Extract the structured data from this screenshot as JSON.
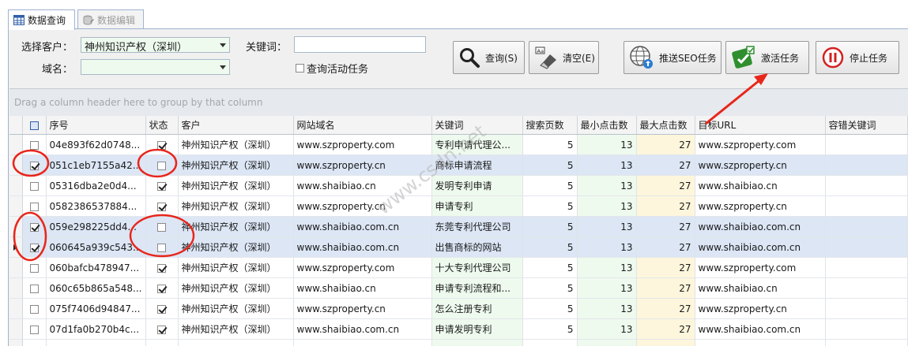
{
  "tabs": [
    {
      "label": "数据查询"
    },
    {
      "label": "数据编辑"
    }
  ],
  "filters": {
    "customer_label": "选择客户：",
    "customer_value": "神州知识产权（深圳）",
    "domain_label": "域名：",
    "domain_value": "",
    "keyword_label": "关键词：",
    "keyword_value": "",
    "active_task_label": "查询活动任务"
  },
  "buttons": {
    "query": "查询(S)",
    "clear": "清空(E)",
    "push_seo": "推送SEO任务",
    "activate": "激活任务",
    "stop": "停止任务"
  },
  "group_hint": "Drag a column header here to group by that column",
  "columns": [
    "序号",
    "状态",
    "客户",
    "网站域名",
    "关键词",
    "搜索页数",
    "最小点击数",
    "最大点击数",
    "目标URL",
    "容错关键词"
  ],
  "rows": [
    {
      "checked": false,
      "id": "04e893f62d0748...",
      "status": true,
      "customer": "神州知识产权（深圳）",
      "domain": "www.szproperty.com",
      "keyword": "专利申请代理公...",
      "pages": "5",
      "min": "13",
      "max": "27",
      "url": "www.szproperty.com",
      "fault_kw": "",
      "selected": false,
      "current": false
    },
    {
      "checked": true,
      "id": "051c1eb7155a42...",
      "status": false,
      "customer": "神州知识产权（深圳）",
      "domain": "www.szproperty.cn",
      "keyword": "商标申请流程",
      "pages": "5",
      "min": "13",
      "max": "27",
      "url": "www.szproperty.cn",
      "fault_kw": "",
      "selected": true,
      "current": false
    },
    {
      "checked": false,
      "id": "05316dba2e0d4...",
      "status": true,
      "customer": "神州知识产权（深圳）",
      "domain": "www.shaibiao.cn",
      "keyword": "发明专利申请",
      "pages": "5",
      "min": "13",
      "max": "27",
      "url": "www.shaibiao.cn",
      "fault_kw": "",
      "selected": false,
      "current": false
    },
    {
      "checked": false,
      "id": "0582386537884...",
      "status": true,
      "customer": "神州知识产权（深圳）",
      "domain": "www.szproperty.cn",
      "keyword": "申请专利",
      "pages": "5",
      "min": "13",
      "max": "27",
      "url": "www.szproperty.cn",
      "fault_kw": "",
      "selected": false,
      "current": false
    },
    {
      "checked": true,
      "id": "059e298225dd4...",
      "status": false,
      "customer": "神州知识产权（深圳）",
      "domain": "www.shaibiao.com.cn",
      "keyword": "东莞专利代理公司",
      "pages": "5",
      "min": "13",
      "max": "27",
      "url": "www.shaibiao.com.cn",
      "fault_kw": "",
      "selected": true,
      "current": false
    },
    {
      "checked": true,
      "id": "060645a939c543...",
      "status": false,
      "customer": "神州知识产权（深圳）",
      "domain": "www.shaibiao.com.cn",
      "keyword": "出售商标的网站",
      "pages": "5",
      "min": "13",
      "max": "27",
      "url": "www.shaibiao.com.cn",
      "fault_kw": "",
      "selected": true,
      "current": true
    },
    {
      "checked": false,
      "id": "060bafcb478947...",
      "status": true,
      "customer": "神州知识产权（深圳）",
      "domain": "www.szproperty.com",
      "keyword": "十大专利代理公司",
      "pages": "5",
      "min": "13",
      "max": "27",
      "url": "www.szproperty.com",
      "fault_kw": "",
      "selected": false,
      "current": false
    },
    {
      "checked": false,
      "id": "060c65b865a548...",
      "status": true,
      "customer": "神州知识产权（深圳）",
      "domain": "www.shaibiao.cn",
      "keyword": "申请专利流程和...",
      "pages": "5",
      "min": "13",
      "max": "27",
      "url": "www.shaibiao.cn",
      "fault_kw": "",
      "selected": false,
      "current": false
    },
    {
      "checked": false,
      "id": "075f7406d94847...",
      "status": true,
      "customer": "神州知识产权（深圳）",
      "domain": "www.szproperty.cn",
      "keyword": "怎么注册专利",
      "pages": "5",
      "min": "13",
      "max": "27",
      "url": "www.szproperty.cn",
      "fault_kw": "",
      "selected": false,
      "current": false
    },
    {
      "checked": false,
      "id": "07d1fa0b270b4c...",
      "status": true,
      "customer": "神州知识产权（深圳）",
      "domain": "www.shaibiao.com.cn",
      "keyword": "申请发明专利",
      "pages": "5",
      "min": "13",
      "max": "27",
      "url": "www.shaibiao.com.cn",
      "fault_kw": "",
      "selected": false,
      "current": false
    },
    {
      "checked": false,
      "id": "",
      "status": true,
      "customer": "",
      "domain": "",
      "keyword": "",
      "pages": "",
      "min": "",
      "max": "",
      "url": "",
      "fault_kw": "",
      "selected": false,
      "current": false
    }
  ],
  "watermark": "www.csdn.net",
  "colors": {
    "annotation": "#e8261c",
    "selected_row": "#dce6f5",
    "keyword_col": "#eefaee",
    "max_col": "#fdf6dc"
  }
}
